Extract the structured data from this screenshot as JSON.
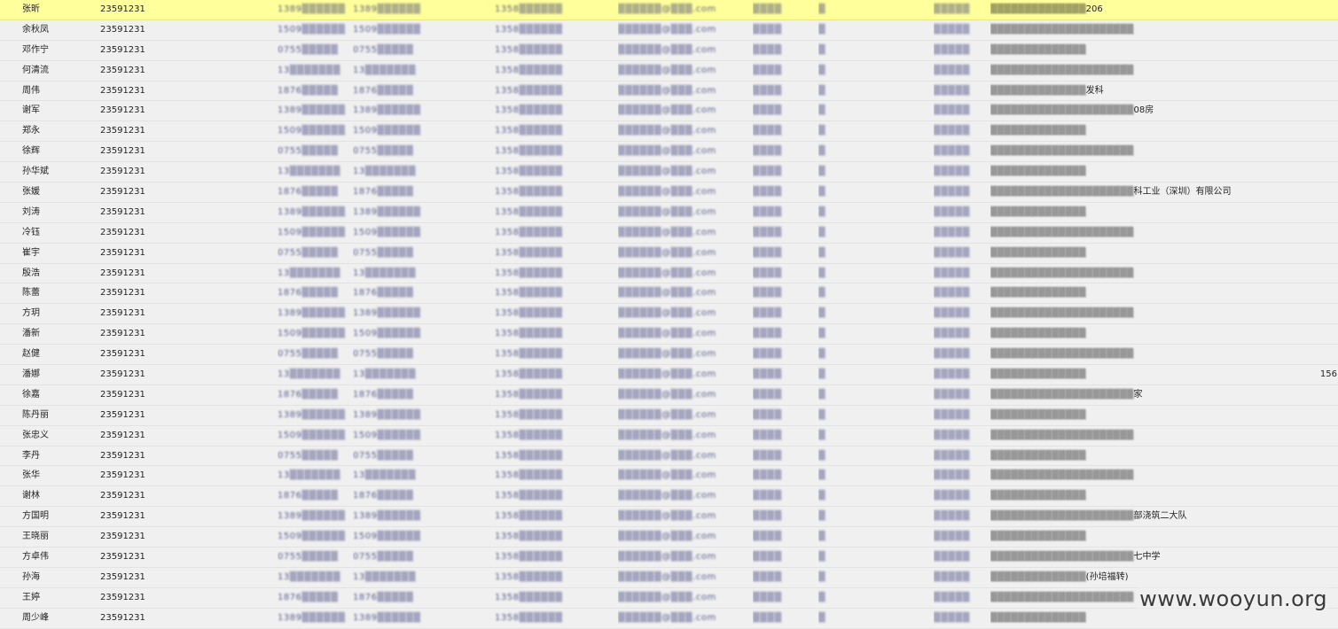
{
  "grid": {
    "rows": [
      {
        "name": "张昕",
        "id": "23591231",
        "addr_tail": "206",
        "selected": true
      },
      {
        "name": "余秋凤",
        "id": "23591231",
        "addr_tail": ""
      },
      {
        "name": "邓作宁",
        "id": "23591231",
        "addr_tail": ""
      },
      {
        "name": "何清流",
        "id": "23591231",
        "addr_tail": ""
      },
      {
        "name": "周伟",
        "id": "23591231",
        "addr_tail": "发科"
      },
      {
        "name": "谢军",
        "id": "23591231",
        "addr_tail": "08房"
      },
      {
        "name": "郑永",
        "id": "23591231",
        "addr_tail": ""
      },
      {
        "name": "徐辉",
        "id": "23591231",
        "addr_tail": ""
      },
      {
        "name": "孙华斌",
        "id": "23591231",
        "addr_tail": ""
      },
      {
        "name": "张媛",
        "id": "23591231",
        "addr_tail": "科工业（深圳）有限公司"
      },
      {
        "name": "刘涛",
        "id": "23591231",
        "addr_tail": ""
      },
      {
        "name": "冷钰",
        "id": "23591231",
        "addr_tail": ""
      },
      {
        "name": "崔宇",
        "id": "23591231",
        "addr_tail": ""
      },
      {
        "name": "殷浩",
        "id": "23591231",
        "addr_tail": ""
      },
      {
        "name": "陈蕾",
        "id": "23591231",
        "addr_tail": ""
      },
      {
        "name": "方玥",
        "id": "23591231",
        "addr_tail": ""
      },
      {
        "name": "潘新",
        "id": "23591231",
        "addr_tail": ""
      },
      {
        "name": "赵健",
        "id": "23591231",
        "addr_tail": ""
      },
      {
        "name": "潘娜",
        "id": "23591231",
        "addr_tail": "",
        "extra": "156"
      },
      {
        "name": "徐嘉",
        "id": "23591231",
        "addr_tail": "家"
      },
      {
        "name": "陈丹丽",
        "id": "23591231",
        "addr_tail": ""
      },
      {
        "name": "张忠义",
        "id": "23591231",
        "addr_tail": ""
      },
      {
        "name": "李丹",
        "id": "23591231",
        "addr_tail": ""
      },
      {
        "name": "张华",
        "id": "23591231",
        "addr_tail": ""
      },
      {
        "name": "谢林",
        "id": "23591231",
        "addr_tail": ""
      },
      {
        "name": "方国明",
        "id": "23591231",
        "addr_tail": "部浇筑二大队"
      },
      {
        "name": "王晓丽",
        "id": "23591231",
        "addr_tail": ""
      },
      {
        "name": "方卓伟",
        "id": "23591231",
        "addr_tail": "七中学"
      },
      {
        "name": "孙海",
        "id": "23591231",
        "addr_tail": "(孙培福转)"
      },
      {
        "name": "王婷",
        "id": "23591231",
        "addr_tail": ""
      },
      {
        "name": "周少峰",
        "id": "23591231",
        "addr_tail": ""
      }
    ]
  },
  "watermark": "www.wooyun.org",
  "colors": {
    "selected_row": "#ffff9c",
    "row": "#f0f0f0"
  }
}
